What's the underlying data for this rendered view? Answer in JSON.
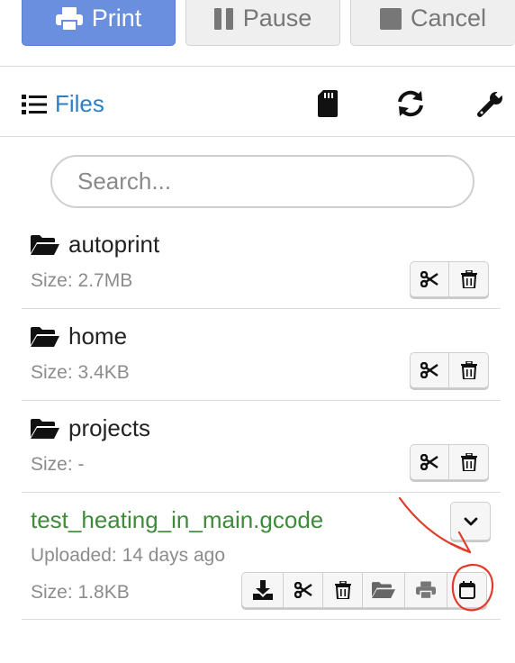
{
  "toolbar": {
    "print_label": "Print",
    "pause_label": "Pause",
    "cancel_label": "Cancel"
  },
  "header": {
    "files_label": "Files"
  },
  "search": {
    "placeholder": "Search..."
  },
  "files": [
    {
      "name": "autoprint",
      "type": "folder",
      "size": "Size: 2.7MB"
    },
    {
      "name": "home",
      "type": "folder",
      "size": "Size: 3.4KB"
    },
    {
      "name": "projects",
      "type": "folder",
      "size": "Size: -"
    },
    {
      "name": "test_heating_in_main.gcode",
      "type": "gcode",
      "uploaded": "Uploaded: 14 days ago",
      "size": "Size: 1.8KB"
    }
  ],
  "colors": {
    "primary": "#6a8fde",
    "link": "#2d7ec2",
    "gcode_name": "#3f8a3b",
    "annotation": "#e23b2a"
  },
  "icons": {
    "print": "print-icon",
    "pause": "pause-icon",
    "cancel": "stop-icon",
    "files": "list-icon",
    "sd": "sd-card-icon",
    "refresh": "refresh-icon",
    "settings": "wrench-icon"
  }
}
